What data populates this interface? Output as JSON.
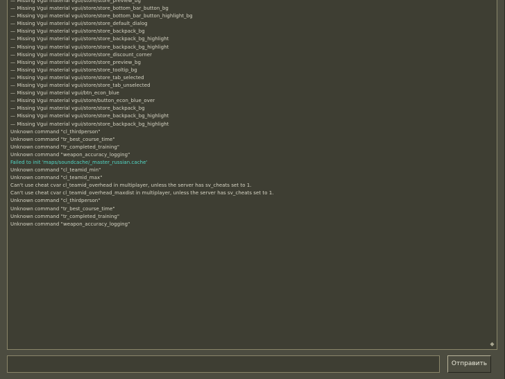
{
  "console": {
    "lines": [
      {
        "text": "— Missing Vgui material vgui/store/store_preview_bg",
        "type": "normal"
      },
      {
        "text": "— Missing Vgui material vgui/store/store_bottom_bar_button_bg",
        "type": "normal"
      },
      {
        "text": "— Missing Vgui material vgui/store/store_bottom_bar_button_highlight_bg",
        "type": "normal"
      },
      {
        "text": "— Missing Vgui material vgui/store/store_default_dialog",
        "type": "normal"
      },
      {
        "text": "— Missing Vgui material vgui/store/store_backpack_bg",
        "type": "normal"
      },
      {
        "text": "— Missing Vgui material vgui/store/store_backpack_bg_highlight",
        "type": "normal"
      },
      {
        "text": "— Missing Vgui material vgui/store/store_backpack_bg_highlight",
        "type": "normal"
      },
      {
        "text": "— Missing Vgui material vgui/store/store_discount_corner",
        "type": "normal"
      },
      {
        "text": "— Missing Vgui material vgui/store/store_preview_bg",
        "type": "normal"
      },
      {
        "text": "— Missing Vgui material vgui/store/store_tooltip_bg",
        "type": "normal"
      },
      {
        "text": "— Missing Vgui material vgui/store/store_tab_selected",
        "type": "normal"
      },
      {
        "text": "— Missing Vgui material vgui/store/store_tab_unselected",
        "type": "normal"
      },
      {
        "text": "— Missing Vgui material vgui/btn_econ_blue",
        "type": "normal"
      },
      {
        "text": "— Missing Vgui material vgui/store/button_econ_blue_over",
        "type": "normal"
      },
      {
        "text": "— Missing Vgui material vgui/store/store_backpack_bg",
        "type": "normal"
      },
      {
        "text": "— Missing Vgui material vgui/store/store_backpack_bg_highlight",
        "type": "normal"
      },
      {
        "text": "— Missing Vgui material vgui/store/store_backpack_bg_highlight",
        "type": "normal"
      },
      {
        "text": "Unknown command \"cl_thirdperson\"",
        "type": "normal"
      },
      {
        "text": "Unknown command \"tr_best_course_time\"",
        "type": "normal"
      },
      {
        "text": "Unknown command \"tr_completed_training\"",
        "type": "normal"
      },
      {
        "text": "Unknown command \"weapon_accuracy_logging\"",
        "type": "normal"
      },
      {
        "text": "Failed to init 'maps/soundcache/_master_russian.cache'",
        "type": "error"
      },
      {
        "text": "Unknown command \"cl_teamid_min\"",
        "type": "normal"
      },
      {
        "text": "Unknown command \"cl_teamid_max\"",
        "type": "normal"
      },
      {
        "text": "Can't use cheat cvar cl_teamid_overhead in multiplayer, unless the server has sv_cheats set to 1.",
        "type": "normal"
      },
      {
        "text": "Can't use cheat cvar cl_teamid_overhead_maxdist in multiplayer, unless the server has sv_cheats set to 1.",
        "type": "normal"
      },
      {
        "text": "Unknown command \"cl_thirdperson\"",
        "type": "normal"
      },
      {
        "text": "Unknown command \"tr_best_course_time\"",
        "type": "normal"
      },
      {
        "text": "Unknown command \"tr_completed_training\"",
        "type": "normal"
      },
      {
        "text": "Unknown command \"weapon_accuracy_logging\"",
        "type": "normal"
      }
    ],
    "scroll_icon": "scroll-down-diamond-icon"
  },
  "input": {
    "value": "",
    "placeholder": ""
  },
  "submit": {
    "label": "Отправить"
  },
  "colors": {
    "background": "#4c4c40",
    "console_bg": "#3e3e33",
    "text": "#d8d6c6",
    "error_text": "#52d9c8",
    "border": "#8a866a"
  }
}
